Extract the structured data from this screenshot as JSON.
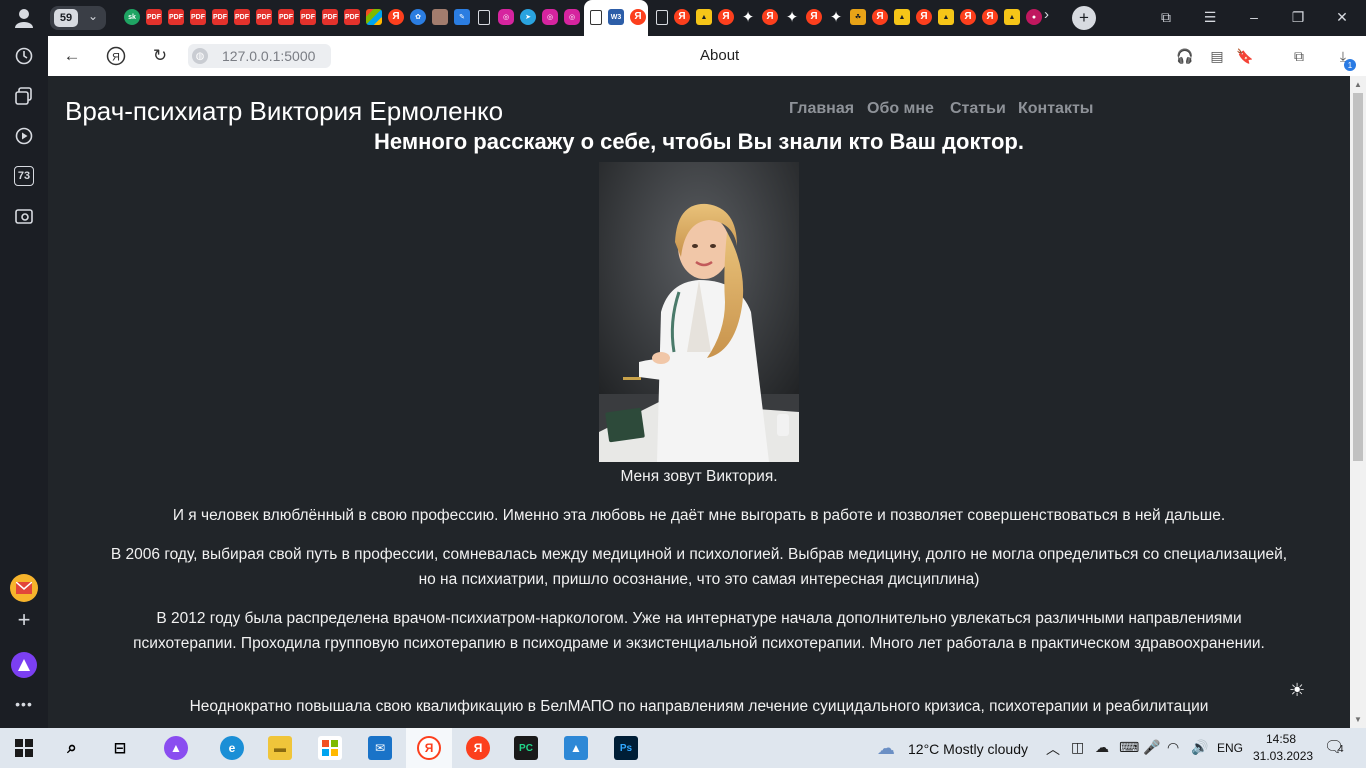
{
  "browser": {
    "tab_count": "59",
    "address": "127.0.0.1:5000",
    "page_title": "About",
    "download_badge": "1",
    "sidebar_badge": "73"
  },
  "site": {
    "brand": "Врач-психиатр Виктория Ермоленко",
    "nav": [
      "Главная",
      "Обо мне",
      "Статьи",
      "Контакты"
    ],
    "hero_title": "Немного расскажу о себе, чтобы Вы знали кто Ваш доктор.",
    "photo_alt": "",
    "paragraphs": [
      "Меня зовут Виктория.",
      "И я человек влюблённый в свою профессию. Именно эта любовь не даёт мне выгорать в работе и позволяет совершенствоваться в ней дальше.",
      "В 2006 году, выбирая свой путь в профессии, сомневалась между медициной и психологией. Выбрав медицину, долго не могла определиться со специализацией, но на психиатрии, пришло осознание, что это самая интересная дисциплина)",
      "В 2012 году была распределена врачом-психиатром-наркологом. Уже на интернатуре начала дополнительно увлекаться различными направлениями психотерапии. Проходила групповую психотерапию в психодраме и экзистенциальной психотерапии. Много лет работала в практическом здравоохранении.",
      "Неоднократно повышала свою квалификацию в БелМАПО по направлениям лечение суицидального кризиса, психотерапии и реабилитации"
    ]
  },
  "taskbar": {
    "weather": "12°C  Mostly cloudy",
    "lang": "ENG",
    "time": "14:58",
    "date": "31.03.2023",
    "notifications": "4"
  },
  "colors": {
    "page_bg": "#212529",
    "nav_text": "#8e9298",
    "browser_chrome": "#1b1e24"
  }
}
